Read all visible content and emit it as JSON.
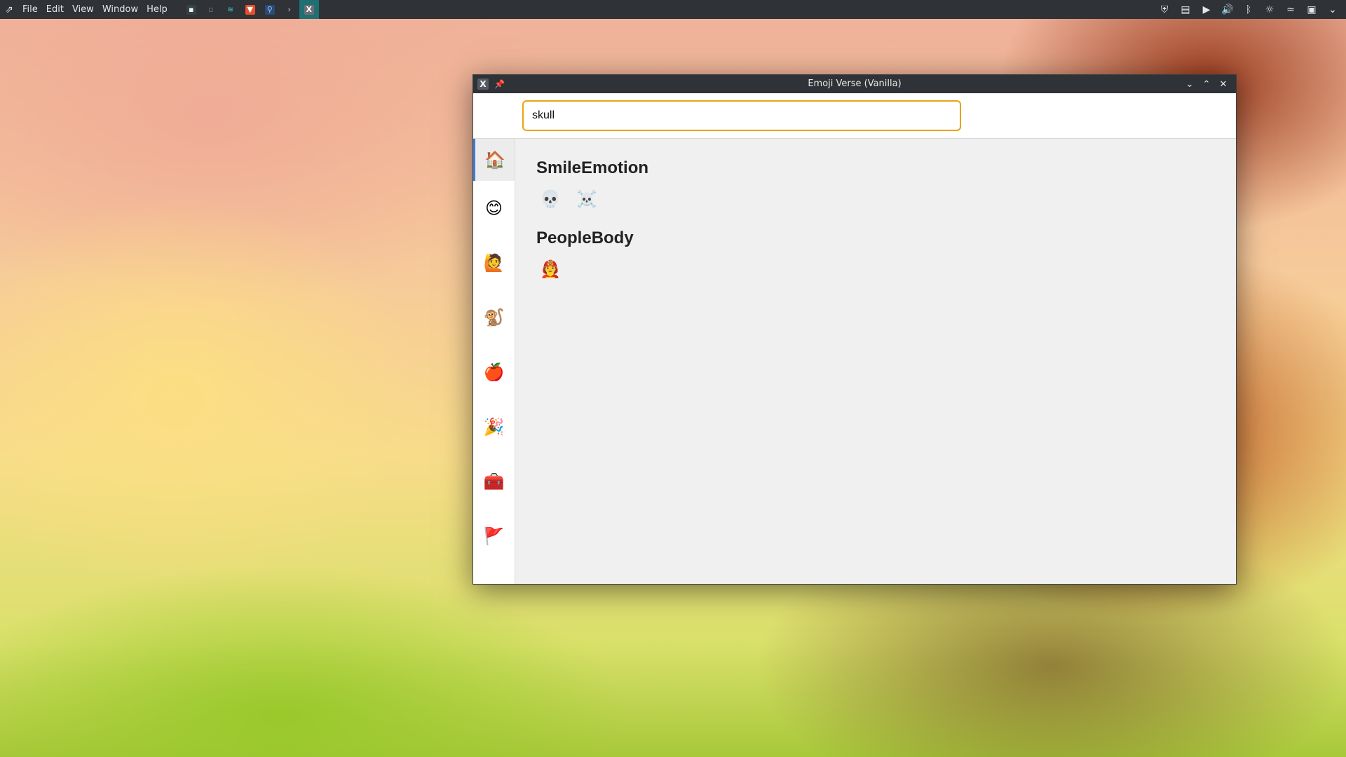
{
  "panel": {
    "menus": [
      "File",
      "Edit",
      "View",
      "Window",
      "Help"
    ],
    "task_icons": [
      {
        "name": "terminal-icon",
        "glyph": "▪"
      },
      {
        "name": "document-icon",
        "glyph": "▫"
      },
      {
        "name": "files-icon",
        "glyph": "≋"
      },
      {
        "name": "brave-icon",
        "glyph": "▼"
      },
      {
        "name": "remote-icon",
        "glyph": "⚲"
      },
      {
        "name": "console-icon",
        "glyph": "›"
      },
      {
        "name": "emoji-verse-icon",
        "glyph": "X"
      }
    ],
    "tray_icons": [
      {
        "name": "shield-icon",
        "glyph": "⛨"
      },
      {
        "name": "clipboard-icon",
        "glyph": "▤"
      },
      {
        "name": "media-play-icon",
        "glyph": "▶"
      },
      {
        "name": "volume-icon",
        "glyph": "🔊"
      },
      {
        "name": "bluetooth-icon",
        "glyph": "ᛒ"
      },
      {
        "name": "brightness-icon",
        "glyph": "☼"
      },
      {
        "name": "wifi-icon",
        "glyph": "≈"
      },
      {
        "name": "display-icon",
        "glyph": "▣"
      },
      {
        "name": "chevron-down-icon",
        "glyph": "⌄"
      }
    ]
  },
  "window": {
    "title": "Emoji Verse (Vanilla)",
    "app_icon": "X",
    "pin_glyph": "📌",
    "controls": {
      "minimize": "⌄",
      "maximize": "⌃",
      "close": "✕"
    }
  },
  "search": {
    "value": "skull"
  },
  "sidebar": {
    "items": [
      {
        "name": "home",
        "emoji": "🏠",
        "active": true
      },
      {
        "name": "smileys",
        "emoji": "😊"
      },
      {
        "name": "people",
        "emoji": "🙋"
      },
      {
        "name": "animals",
        "emoji": "🐒"
      },
      {
        "name": "food",
        "emoji": "🍎"
      },
      {
        "name": "activities",
        "emoji": "🎉"
      },
      {
        "name": "objects",
        "emoji": "🧰"
      },
      {
        "name": "flags",
        "emoji": "🚩"
      }
    ]
  },
  "results": {
    "groups": [
      {
        "title": "SmileEmotion",
        "emojis": [
          "💀",
          "☠️"
        ]
      },
      {
        "title": "PeopleBody",
        "emojis": [
          "🧑‍🚒"
        ]
      }
    ]
  },
  "colors": {
    "accent_focus": "#e8a317",
    "active_indicator": "#3b7bd6",
    "panel_bg": "#2f3236"
  }
}
